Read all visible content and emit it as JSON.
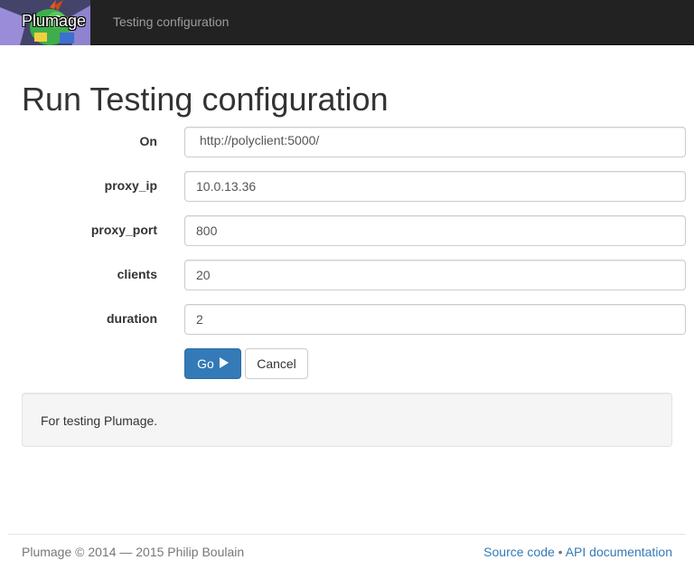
{
  "navbar": {
    "brand": "Plumage",
    "link": "Testing configuration"
  },
  "page": {
    "title": "Run Testing configuration"
  },
  "form": {
    "on": {
      "label": "On",
      "value": "http://polyclient:5000/"
    },
    "proxy_ip": {
      "label": "proxy_ip",
      "value": "10.0.13.36"
    },
    "proxy_port": {
      "label": "proxy_port",
      "value": "800"
    },
    "clients": {
      "label": "clients",
      "value": "20"
    },
    "duration": {
      "label": "duration",
      "value": "2"
    },
    "go_label": "Go",
    "cancel_label": "Cancel"
  },
  "well": {
    "text": "For testing Plumage."
  },
  "footer": {
    "copyright": "Plumage © 2014 — 2015 Philip Boulain",
    "source_link": "Source code",
    "separator": "•",
    "api_link": "API documentation"
  },
  "colors": {
    "navbar": "#222222",
    "primary": "#337ab7",
    "well": "#f5f5f5"
  },
  "icons": {
    "go": "play-icon",
    "brand": "parrot-logo-icon"
  }
}
